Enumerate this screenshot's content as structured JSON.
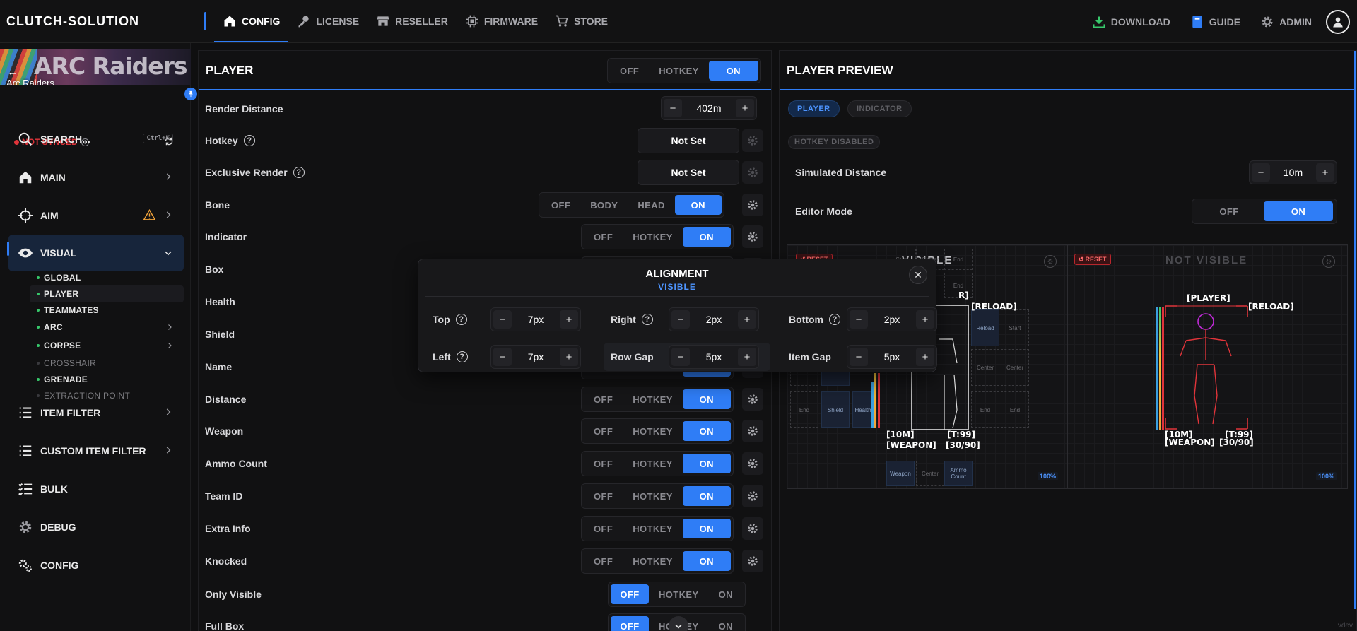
{
  "brand": "CLUTCH-SOLUTION",
  "nav": {
    "items": [
      {
        "label": "CONFIG",
        "icon": "home-icon",
        "active": true
      },
      {
        "label": "LICENSE",
        "icon": "key-icon"
      },
      {
        "label": "RESELLER",
        "icon": "store-icon"
      },
      {
        "label": "FIRMWARE",
        "icon": "chip-icon"
      },
      {
        "label": "STORE",
        "icon": "cart-icon"
      }
    ],
    "right": [
      {
        "label": "DOWNLOAD",
        "icon": "download-icon",
        "color": "#37c86b"
      },
      {
        "label": "GUIDE",
        "icon": "book-icon",
        "color": "#2f7df6"
      },
      {
        "label": "ADMIN",
        "icon": "gear-icon",
        "color": "#9a9a9f"
      }
    ]
  },
  "sidebar": {
    "game": "Arc Raiders",
    "banner_text": "ARC Raiders",
    "sync_status": "NOT SYNCED",
    "search": {
      "label": "SEARCH...",
      "shortcut": "Ctrl+K"
    },
    "items": [
      {
        "label": "MAIN",
        "icon": "home-icon"
      },
      {
        "label": "AIM",
        "icon": "crosshair-icon",
        "warning": true
      },
      {
        "label": "VISUAL",
        "icon": "eye-icon",
        "active": true
      },
      {
        "label": "ITEM FILTER",
        "icon": "list-icon"
      },
      {
        "label": "CUSTOM ITEM FILTER",
        "icon": "list-icon"
      },
      {
        "label": "BULK",
        "icon": "checklist-icon"
      },
      {
        "label": "DEBUG",
        "icon": "gear-icon"
      },
      {
        "label": "CONFIG",
        "icon": "gears-icon"
      }
    ],
    "sub_items": [
      {
        "label": "GLOBAL",
        "enabled": true
      },
      {
        "label": "PLAYER",
        "enabled": true,
        "active": true
      },
      {
        "label": "TEAMMATES",
        "enabled": true
      },
      {
        "label": "ARC",
        "enabled": true,
        "has_children": true
      },
      {
        "label": "CORPSE",
        "enabled": true,
        "has_children": true
      },
      {
        "label": "CROSSHAIR",
        "enabled": false
      },
      {
        "label": "GRENADE",
        "enabled": true
      },
      {
        "label": "EXTRACTION POINT",
        "enabled": false
      }
    ]
  },
  "player": {
    "title": "PLAYER",
    "mode": {
      "options": [
        "OFF",
        "HOTKEY",
        "ON"
      ],
      "selected": "ON"
    },
    "render_distance": {
      "label": "Render Distance",
      "value": "402m"
    },
    "hotkey": {
      "label": "Hotkey",
      "value": "Not Set"
    },
    "exclusive_render": {
      "label": "Exclusive Render",
      "value": "Not Set"
    },
    "bone": {
      "label": "Bone",
      "options": [
        "OFF",
        "BODY",
        "HEAD",
        "ON"
      ],
      "selected": "ON"
    },
    "rows": [
      {
        "label": "Indicator",
        "selected": "ON"
      },
      {
        "label": "Box",
        "selected": "ON"
      },
      {
        "label": "Health",
        "selected": "ON"
      },
      {
        "label": "Shield",
        "selected": "ON"
      },
      {
        "label": "Name",
        "selected": "ON"
      },
      {
        "label": "Distance",
        "selected": "ON"
      },
      {
        "label": "Weapon",
        "selected": "ON"
      },
      {
        "label": "Ammo Count",
        "selected": "ON"
      },
      {
        "label": "Team ID",
        "selected": "ON"
      },
      {
        "label": "Extra Info",
        "selected": "ON"
      },
      {
        "label": "Knocked",
        "selected": "ON"
      }
    ],
    "only_visible": {
      "label": "Only Visible",
      "selected": "OFF"
    },
    "full_box": {
      "label": "Full Box",
      "selected": "OFF"
    },
    "toggle_options": [
      "OFF",
      "HOTKEY",
      "ON"
    ]
  },
  "preview": {
    "title": "PLAYER PREVIEW",
    "tabs": [
      "PLAYER",
      "INDICATOR"
    ],
    "hotkey_badge": "HOTKEY DISABLED",
    "simulated_distance": {
      "label": "Simulated Distance",
      "value": "10m"
    },
    "editor_mode": {
      "label": "Editor Mode",
      "options": [
        "OFF",
        "ON"
      ],
      "selected": "ON"
    },
    "visible_head": "VISIBLE",
    "not_visible_head": "NOT VISIBLE",
    "reset_label": "RESET",
    "zoom": "100%",
    "esp": {
      "player": "[PLAYER]",
      "reload": "[RELOAD]",
      "distance": "[10M]",
      "team": "[T:99]",
      "weapon": "[WEAPON]",
      "ammo": "[30/90]"
    },
    "grid_labels": {
      "start": "Start",
      "center": "Center",
      "end": "End",
      "reload": "Reload",
      "shield": "Shield",
      "health": "Health",
      "weapon": "Weapon",
      "ammo": "Ammo Count"
    }
  },
  "alignment": {
    "title": "ALIGNMENT",
    "subtitle": "VISIBLE",
    "fields": [
      {
        "label": "Top",
        "value": "7px",
        "help": true
      },
      {
        "label": "Right",
        "value": "2px",
        "help": true
      },
      {
        "label": "Bottom",
        "value": "2px",
        "help": true
      },
      {
        "label": "Left",
        "value": "7px",
        "help": true
      },
      {
        "label": "Row Gap",
        "value": "5px",
        "help": false
      },
      {
        "label": "Item Gap",
        "value": "5px",
        "help": false
      }
    ]
  },
  "footer_text": "vdev",
  "colors": {
    "accent": "#2f7df6",
    "danger": "#e0343a",
    "success": "#37c86b",
    "warning": "#f0a23a"
  }
}
